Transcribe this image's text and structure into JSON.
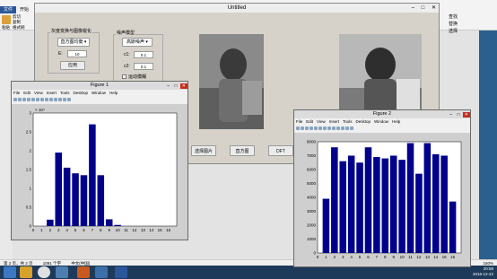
{
  "word": {
    "tabs": [
      "文件",
      "开始"
    ],
    "clipboard": [
      "剪切",
      "复制",
      "格式刷"
    ],
    "paste_label": "粘贴",
    "right_panel": [
      "查找",
      "替换",
      "选择"
    ],
    "status": [
      "第 2 页，共 2 页",
      "1091 个字",
      "中文(中国)"
    ],
    "zoom": "150%"
  },
  "taskbar": {
    "time": "20:58",
    "date": "2016-12-22"
  },
  "gui": {
    "title": "Untitled",
    "panel1": {
      "title": "灰度变换与图像锐化",
      "dropdown": "直方图均衡",
      "e_label": "E:",
      "e_value": "10",
      "apply_button": "应用"
    },
    "panel2": {
      "title": "噪声模型",
      "dropdown": "高斯噪声",
      "c1_label": "c1:",
      "c1_value": "0.1",
      "c2_label": "c2:",
      "c2_value": "0.1",
      "motion_blur": "运动模糊"
    },
    "buttons": [
      "选择图片",
      "直方图",
      "DFT"
    ]
  },
  "figure1": {
    "title": "Figure 1",
    "menus": [
      "File",
      "Edit",
      "View",
      "Insert",
      "Tools",
      "Desktop",
      "Window",
      "Help"
    ],
    "exponent": "× 10⁴",
    "chart_data": {
      "type": "bar",
      "categories": [
        "0",
        "1",
        "2",
        "3",
        "4",
        "5",
        "6",
        "7",
        "8",
        "9",
        "10",
        "11",
        "12",
        "13",
        "14",
        "15",
        "16"
      ],
      "values": [
        0,
        1700,
        19500,
        15500,
        14000,
        13500,
        27000,
        13500,
        1800,
        300,
        0,
        0,
        0,
        0,
        0,
        0,
        0
      ],
      "yticks": [
        "0",
        "0.5",
        "1",
        "1.5",
        "2",
        "2.5",
        "3"
      ],
      "ylim": [
        0,
        30000
      ],
      "xlim": [
        0,
        17
      ],
      "color": "#00008b"
    }
  },
  "figure2": {
    "title": "Figure 2",
    "menus": [
      "File",
      "Edit",
      "View",
      "Insert",
      "Tools",
      "Desktop",
      "Window",
      "Help"
    ],
    "chart_data": {
      "type": "bar",
      "categories": [
        "0",
        "1",
        "2",
        "3",
        "4",
        "5",
        "6",
        "7",
        "8",
        "9",
        "10",
        "11",
        "12",
        "13",
        "14",
        "15",
        "16"
      ],
      "values": [
        3900,
        7600,
        6600,
        7000,
        6500,
        7600,
        6900,
        6800,
        7000,
        6700,
        7900,
        5700,
        7900,
        7100,
        7000,
        3700
      ],
      "yticks": [
        "0",
        "1000",
        "2000",
        "3000",
        "4000",
        "5000",
        "6000",
        "7000",
        "8000"
      ],
      "ylim": [
        0,
        8000
      ],
      "xlim": [
        0,
        17
      ],
      "color": "#00008b"
    }
  }
}
